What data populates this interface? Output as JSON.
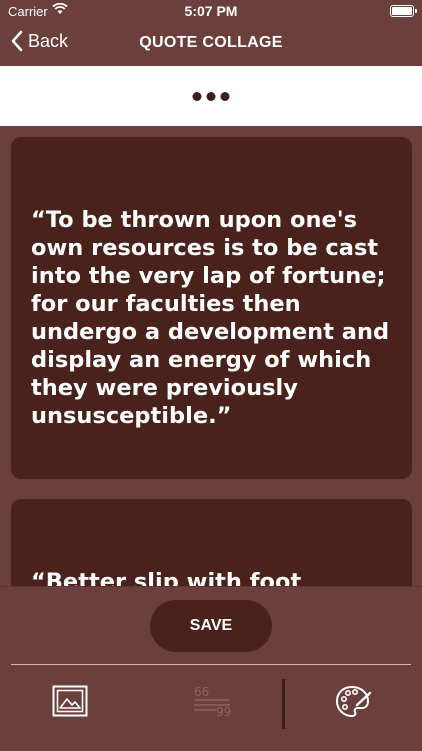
{
  "status_bar": {
    "carrier": "Carrier",
    "time": "5:07 PM"
  },
  "nav": {
    "back_label": "Back",
    "title": "QUOTE COLLAGE"
  },
  "cards": [
    {
      "quote": "“To be thrown upon one's own resources is to be cast into the very lap of fortune; for our faculties then undergo a development and display an energy of which they were previously unsusceptible.”"
    },
    {
      "quote": "“Better slip with foot"
    }
  ],
  "bottom": {
    "save_label": "SAVE"
  },
  "icons": {
    "back": "chevron-left-icon",
    "more": "more-dots-icon",
    "image": "image-icon",
    "quote_format": "quote-format-icon",
    "palette": "palette-icon"
  },
  "colors": {
    "background": "#6b3f3c",
    "card": "#4a221c",
    "toolbar": "#ffffff"
  }
}
